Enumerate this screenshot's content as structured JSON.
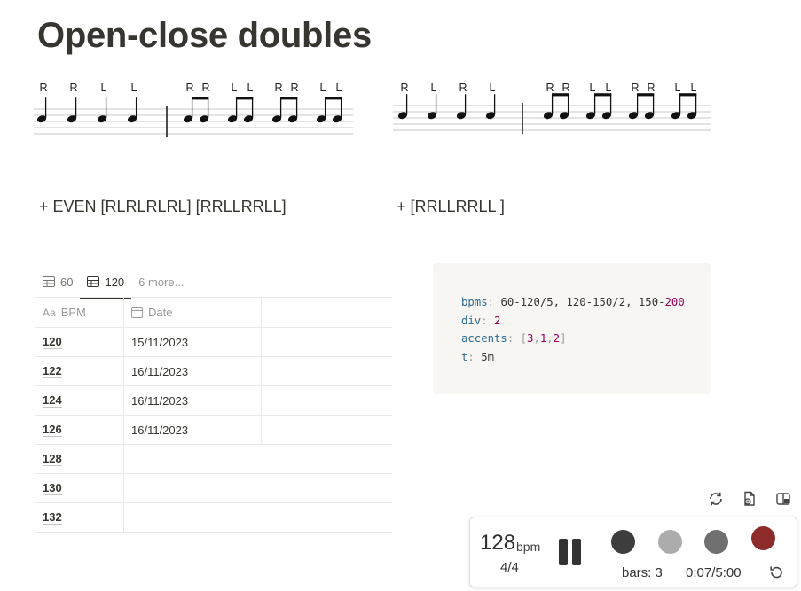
{
  "page": {
    "title": "Open-close doubles"
  },
  "notation": {
    "left": {
      "stickings_bar1": [
        "R",
        "R",
        "L",
        "L"
      ],
      "stickings_bar2": [
        "R",
        "R",
        "L",
        "L",
        "R",
        "R",
        "L",
        "L"
      ]
    },
    "right": {
      "stickings_bar1": [
        "R",
        "L",
        "R",
        "L"
      ],
      "stickings_bar2": [
        "R",
        "R",
        "L",
        "L",
        "R",
        "R",
        "L",
        "L"
      ]
    }
  },
  "toggles": {
    "left": "+ EVEN [RLRLRLRL] [RRLLRRLL]",
    "right": "+ [RRLLRRLL ]"
  },
  "database": {
    "tabs": [
      {
        "label": "60",
        "icon": "table-icon",
        "active": false
      },
      {
        "label": "120",
        "icon": "table-icon",
        "active": true
      }
    ],
    "more_label": "6 more...",
    "columns": [
      {
        "label": "BPM",
        "icon": "text-type-icon"
      },
      {
        "label": "Date",
        "icon": "calendar-icon"
      }
    ],
    "rows": [
      {
        "bpm": "120",
        "date": "15/11/2023"
      },
      {
        "bpm": "122",
        "date": "16/11/2023"
      },
      {
        "bpm": "124",
        "date": "16/11/2023"
      },
      {
        "bpm": "126",
        "date": "16/11/2023"
      },
      {
        "bpm": "128",
        "date": ""
      },
      {
        "bpm": "130",
        "date": ""
      },
      {
        "bpm": "132",
        "date": ""
      }
    ]
  },
  "code": {
    "bpms_key": "bpms",
    "bpms_val": "60-120/5, 120-150/2, 150-",
    "bpms_tail": "200",
    "div_key": "div",
    "div_val": "2",
    "accents_key": "accents",
    "accents_open": "[",
    "accents_vals": [
      "3",
      "1",
      "2"
    ],
    "accents_close": "]",
    "t_key": "t",
    "t_val": "5m"
  },
  "player": {
    "bpm": "128",
    "bpm_unit": "bpm",
    "time_signature": "4/4",
    "bars_label": "bars: 3",
    "timer": "0:07/5:00",
    "dots": [
      {
        "name": "accent-dot-dark",
        "color": "#3d3d3d"
      },
      {
        "name": "accent-dot-light",
        "color": "#acacac"
      },
      {
        "name": "accent-dot-mid",
        "color": "#6f6f6f"
      },
      {
        "name": "accent-dot-red",
        "color": "#8e2b2b"
      }
    ]
  },
  "toolbar_icons": [
    "sync-icon",
    "export-file-icon",
    "layout-toggle-icon"
  ]
}
